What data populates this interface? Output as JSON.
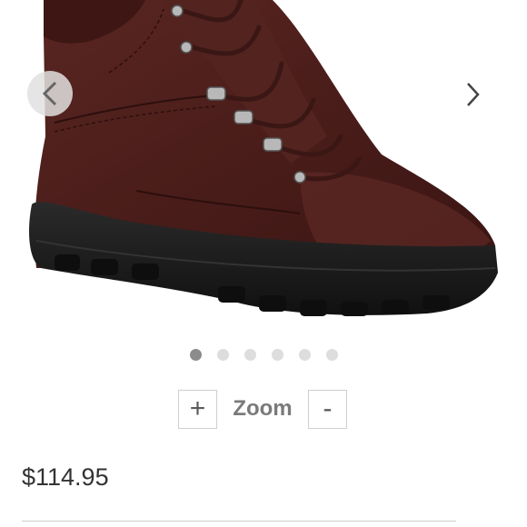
{
  "product": {
    "image_alt": "Brown leather lace-up hiking boot",
    "price": "$114.95"
  },
  "carousel": {
    "prev_icon": "chevron-left-icon",
    "next_icon": "chevron-right-icon",
    "total_slides": 6,
    "active_slide": 1
  },
  "zoom": {
    "plus_label": "+",
    "label": "Zoom",
    "minus_label": "-"
  },
  "colors": {
    "leather": "#4a1d1a",
    "sole": "#1c1c1c",
    "dot_active": "#8c8c8c",
    "dot_inactive": "#dddddd"
  }
}
